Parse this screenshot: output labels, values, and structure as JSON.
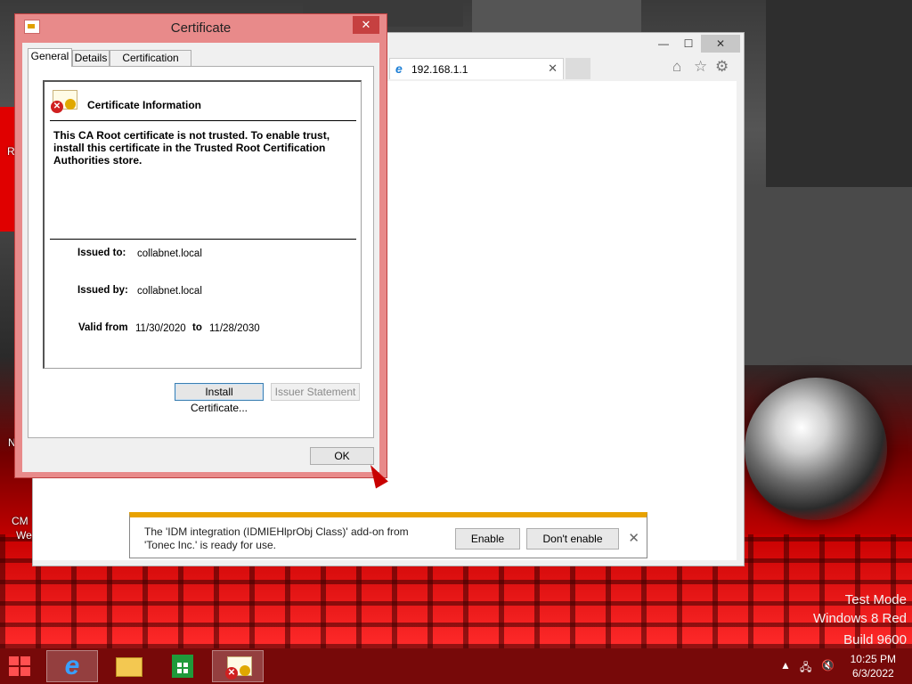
{
  "desktop": {
    "watermark": [
      "Test Mode",
      "Windows 8 Red",
      "Build 9600"
    ],
    "icon_fragments": [
      "R",
      "N",
      "CM",
      "We"
    ]
  },
  "ie": {
    "tab_title": "192.168.1.1",
    "controls": {
      "minimize": "—",
      "maximize": "☐",
      "close": "✕"
    },
    "icons": [
      "home-icon",
      "favorites-star-icon",
      "tools-gear-icon"
    ],
    "notification": {
      "message": "The 'IDM integration (IDMIEHlprObj Class)' add-on from 'Tonec Inc.' is ready for use.",
      "enable_label": "Enable",
      "dont_enable_label": "Don't enable",
      "close_glyph": "✕",
      "accent": "#e8a200"
    }
  },
  "certificate": {
    "title": "Certificate",
    "close_glyph": "✕",
    "tabs": [
      {
        "label": "General",
        "active": true
      },
      {
        "label": "Details",
        "active": false
      },
      {
        "label": "Certification Path",
        "active": false
      }
    ],
    "info_title": "Certificate Information",
    "message": "This CA Root certificate is not trusted. To enable trust, install this certificate in the Trusted Root Certification Authorities store.",
    "issued_to_label": "Issued to:",
    "issued_to": "collabnet.local",
    "issued_by_label": "Issued by:",
    "issued_by": "collabnet.local",
    "valid_from_label": "Valid from",
    "valid_from": "11/30/2020",
    "to_label": "to",
    "valid_to": "11/28/2030",
    "install_button": "Install Certificate...",
    "issuer_statement_button": "Issuer Statement",
    "ok_button": "OK",
    "frame_color": "#e88a8a"
  },
  "taskbar": {
    "items": [
      "start-button",
      "internet-explorer",
      "file-explorer",
      "store",
      "certificate-window"
    ],
    "clock_time": "10:25 PM",
    "clock_date": "6/3/2022",
    "tray_icons": [
      "show-hidden-icons-arrow",
      "network-icon",
      "volume-muted-icon"
    ]
  }
}
